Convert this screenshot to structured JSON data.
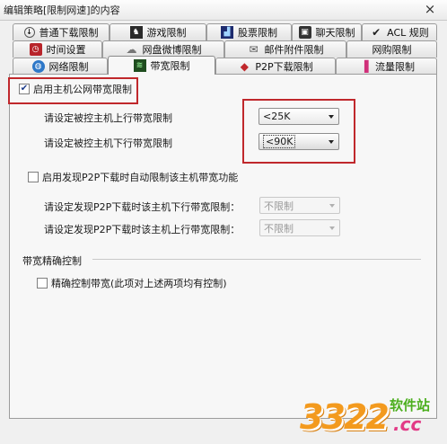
{
  "window": {
    "title": "编辑策略[限制网速]的内容",
    "close_glyph": "×"
  },
  "tabs": {
    "row1": [
      {
        "label": "普通下载限制",
        "icon": "download-icon"
      },
      {
        "label": "游戏限制",
        "icon": "game-icon"
      },
      {
        "label": "股票限制",
        "icon": "stock-icon"
      },
      {
        "label": "聊天限制",
        "icon": "chat-icon"
      },
      {
        "label": "ACL 规则",
        "icon": "acl-icon"
      }
    ],
    "row2": [
      {
        "label": "时间设置",
        "icon": "clock-icon"
      },
      {
        "label": "网盘微博限制",
        "icon": "cloud-icon"
      },
      {
        "label": "邮件附件限制",
        "icon": "mail-icon"
      },
      {
        "label": "网购限制",
        "icon": ""
      }
    ],
    "row3": [
      {
        "label": "网络限制",
        "icon": "globe-icon"
      },
      {
        "label": "带宽限制",
        "icon": "bandwidth-icon"
      },
      {
        "label": "P2P下载限制",
        "icon": "p2p-icon"
      },
      {
        "label": "流量限制",
        "icon": "traffic-icon"
      }
    ],
    "active": "带宽限制"
  },
  "bandwidth": {
    "enable_label": "启用主机公网带宽限制",
    "enable_checked": true,
    "upload_label": "请设定被控主机上行带宽限制",
    "upload_value": "<25K",
    "download_label": "请设定被控主机下行带宽限制",
    "download_value": "<90K"
  },
  "p2p": {
    "enable_label": "启用发现P2P下载时自动限制该主机带宽功能",
    "enable_checked": false,
    "download_label": "请设定发现P2P下载时该主机下行带宽限制：",
    "download_value": "不限制",
    "upload_label": "请设定发现P2P下载时该主机上行带宽限制：",
    "upload_value": "不限制"
  },
  "precise": {
    "group_title": "带宽精确控制",
    "checkbox_label": "精确控制带宽(此项对上述两项均有控制)",
    "checked": false
  },
  "watermark": {
    "number": "3322",
    "site": "软件站",
    "domain": ".cc"
  },
  "colors": {
    "highlight_box": "#c0282c",
    "watermark_orange": "#f39a1e",
    "watermark_green": "#4caf1e"
  }
}
